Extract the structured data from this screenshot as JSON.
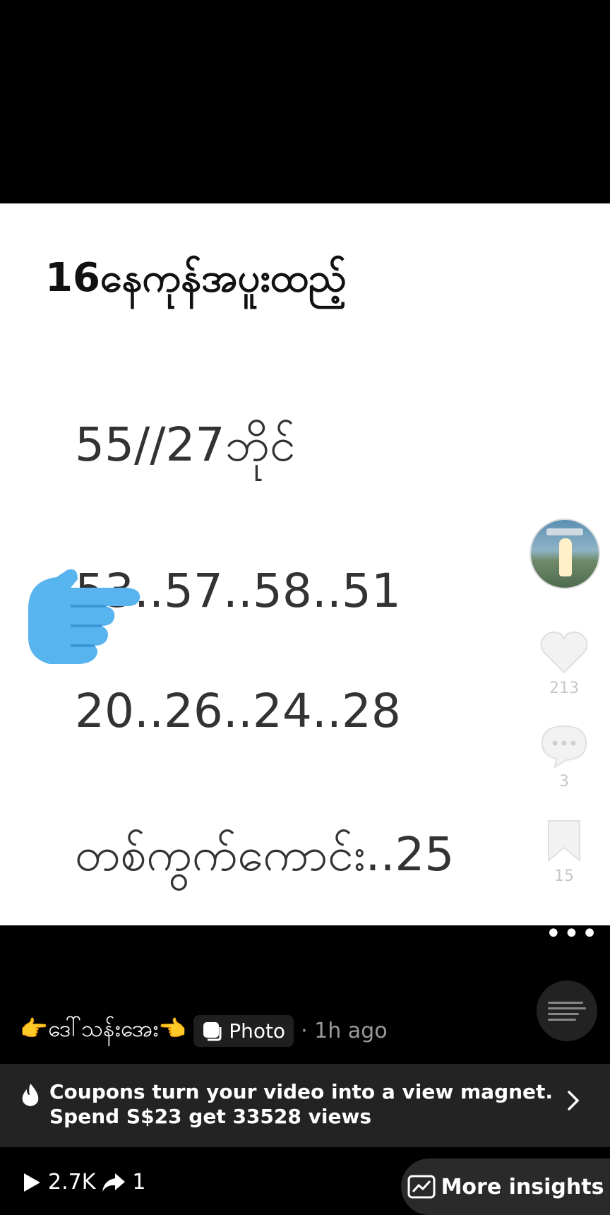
{
  "post_lines": {
    "title": "16နေကုန်အပူးထည့်",
    "line1": "55//27ဘိုင်",
    "line2": "53..57..58..51",
    "line3": "20..26..24..28",
    "line4": "တစ်ကွက်ကောင်း..25"
  },
  "side_rail": {
    "likes": "213",
    "comments": "3",
    "saves": "15"
  },
  "caption": {
    "author": "👉ဒေါ်သန်းအေး👈",
    "type_chip": "Photo",
    "time": "· 1h ago"
  },
  "coupon": {
    "line1": "Coupons turn your video into a view magnet.",
    "line2": "Spend S$23 get 33528 views"
  },
  "stats": {
    "views": "2.7K",
    "shares": "1"
  },
  "insights_button": "More insights",
  "icons": [
    "hand-pointer-icon",
    "heart-icon",
    "comment-icon",
    "bookmark-icon",
    "more-icon",
    "fire-icon",
    "chevron-right-icon",
    "play-icon",
    "share-icon",
    "chart-icon",
    "photo-icon"
  ]
}
